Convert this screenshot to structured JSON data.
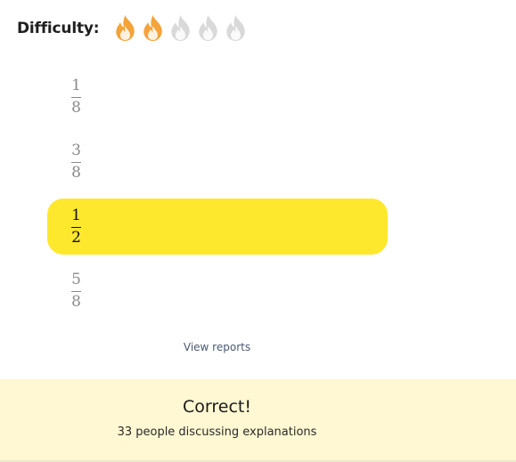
{
  "difficulty": {
    "label": "Difficulty:",
    "rating": 2,
    "max": 5,
    "icon": "flame-icon",
    "active_color": "#f2a33a",
    "inactive_color": "#d9d9d9"
  },
  "options": [
    {
      "numerator": "1",
      "denominator": "8",
      "selected": false
    },
    {
      "numerator": "3",
      "denominator": "8",
      "selected": false
    },
    {
      "numerator": "1",
      "denominator": "2",
      "selected": true
    },
    {
      "numerator": "5",
      "denominator": "8",
      "selected": false
    }
  ],
  "view_reports_label": "View reports",
  "result": {
    "title": "Correct!",
    "discussion_text": "33 people discussing explanations"
  },
  "colors": {
    "selected_option_bg": "#fde82e",
    "result_panel_bg": "#fff8d2"
  }
}
